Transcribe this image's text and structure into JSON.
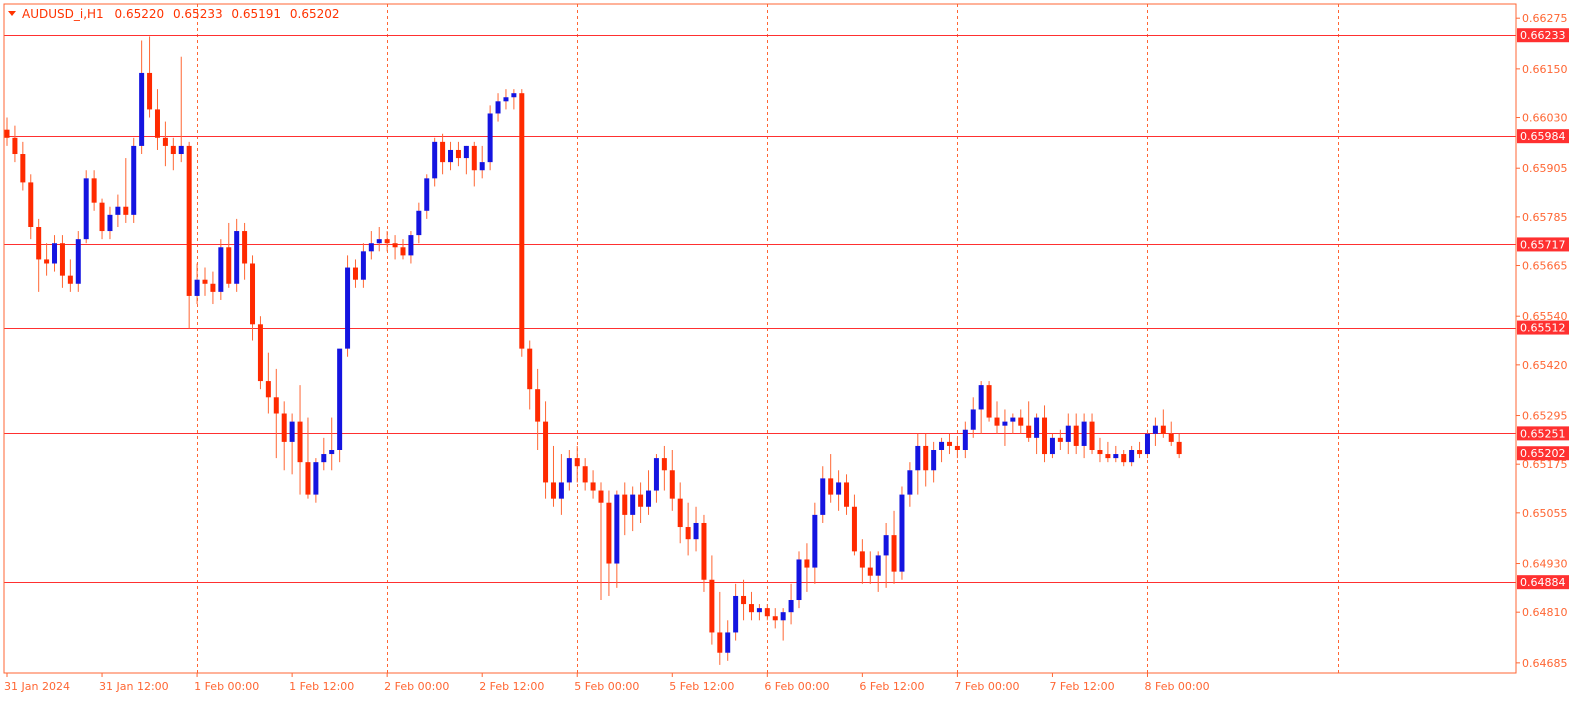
{
  "header": {
    "symbol": "AUDUSD_i,H1",
    "open": "0.65220",
    "high": "0.65233",
    "low": "0.65191",
    "close": "0.65202",
    "marker_color": "#ff3300"
  },
  "colors": {
    "background": "#ffffff",
    "frame": "#ff6633",
    "grid": "#ff6633",
    "bull": "#1414e0",
    "bear": "#ff2a00",
    "level_line": "#ff3030",
    "price_label_bg": "#ff3030",
    "axis_text": "#ff6633",
    "wick": "#ff6633"
  },
  "chart_data": {
    "type": "candlestick",
    "timeframe": "H1",
    "y_range": [
      0.6466,
      0.6631
    ],
    "y_ticks": [
      "0.66275",
      "0.66150",
      "0.66030",
      "0.65905",
      "0.65785",
      "0.65665",
      "0.65540",
      "0.65420",
      "0.65295",
      "0.65175",
      "0.65055",
      "0.64930",
      "0.64810",
      "0.64685"
    ],
    "x_labels": [
      {
        "bar": 0,
        "text": "31 Jan 2024"
      },
      {
        "bar": 12,
        "text": "31 Jan 12:00"
      },
      {
        "bar": 24,
        "text": "1 Feb 00:00"
      },
      {
        "bar": 36,
        "text": "1 Feb 12:00"
      },
      {
        "bar": 48,
        "text": "2 Feb 00:00"
      },
      {
        "bar": 60,
        "text": "2 Feb 12:00"
      },
      {
        "bar": 72,
        "text": "5 Feb 00:00"
      },
      {
        "bar": 84,
        "text": "5 Feb 12:00"
      },
      {
        "bar": 96,
        "text": "6 Feb 00:00"
      },
      {
        "bar": 108,
        "text": "6 Feb 12:00"
      },
      {
        "bar": 120,
        "text": "7 Feb 00:00"
      },
      {
        "bar": 132,
        "text": "7 Feb 12:00"
      },
      {
        "bar": 144,
        "text": "8 Feb 00:00"
      }
    ],
    "vertical_grid_bars": [
      24,
      48,
      72,
      96,
      120,
      144,
      168
    ],
    "horizontal_levels": [
      {
        "value": 0.66233,
        "label": "0.66233"
      },
      {
        "value": 0.65984,
        "label": "0.65984"
      },
      {
        "value": 0.65717,
        "label": "0.65717"
      },
      {
        "value": 0.65512,
        "label": "0.65512"
      },
      {
        "value": 0.65251,
        "label": "0.65251"
      },
      {
        "value": 0.64884,
        "label": "0.64884"
      }
    ],
    "current_price": {
      "value": 0.65202,
      "label": "0.65202"
    },
    "candles": [
      [
        0.66,
        0.6603,
        0.6596,
        0.6598
      ],
      [
        0.6598,
        0.6601,
        0.6592,
        0.6594
      ],
      [
        0.6594,
        0.6597,
        0.6585,
        0.6587
      ],
      [
        0.6587,
        0.6589,
        0.6573,
        0.6576
      ],
      [
        0.6576,
        0.6578,
        0.656,
        0.6568
      ],
      [
        0.6568,
        0.6572,
        0.6564,
        0.6567
      ],
      [
        0.6567,
        0.6574,
        0.6565,
        0.6572
      ],
      [
        0.6572,
        0.6574,
        0.6561,
        0.6564
      ],
      [
        0.6564,
        0.6568,
        0.656,
        0.6562
      ],
      [
        0.6562,
        0.6575,
        0.656,
        0.6573
      ],
      [
        0.6573,
        0.659,
        0.6572,
        0.6588
      ],
      [
        0.6588,
        0.659,
        0.658,
        0.6582
      ],
      [
        0.6582,
        0.6583,
        0.6573,
        0.6575
      ],
      [
        0.6575,
        0.6581,
        0.6573,
        0.6579
      ],
      [
        0.6579,
        0.6584,
        0.6576,
        0.6581
      ],
      [
        0.6581,
        0.6593,
        0.6577,
        0.6579
      ],
      [
        0.6579,
        0.6598,
        0.6577,
        0.6596
      ],
      [
        0.6596,
        0.6622,
        0.6594,
        0.6614
      ],
      [
        0.6614,
        0.6623,
        0.6603,
        0.6605
      ],
      [
        0.6605,
        0.661,
        0.6595,
        0.6598
      ],
      [
        0.6598,
        0.6602,
        0.6591,
        0.6596
      ],
      [
        0.6596,
        0.6598,
        0.659,
        0.6594
      ],
      [
        0.6594,
        0.6618,
        0.6592,
        0.6596
      ],
      [
        0.6596,
        0.6597,
        0.6551,
        0.6559
      ],
      [
        0.6559,
        0.6567,
        0.6557,
        0.6563
      ],
      [
        0.6563,
        0.6566,
        0.6559,
        0.6562
      ],
      [
        0.6562,
        0.6565,
        0.6557,
        0.656
      ],
      [
        0.656,
        0.6573,
        0.6558,
        0.6571
      ],
      [
        0.6571,
        0.6577,
        0.6561,
        0.6562
      ],
      [
        0.6562,
        0.6578,
        0.656,
        0.6575
      ],
      [
        0.6575,
        0.6577,
        0.6563,
        0.6567
      ],
      [
        0.6567,
        0.6569,
        0.6548,
        0.6552
      ],
      [
        0.6552,
        0.6554,
        0.6536,
        0.6538
      ],
      [
        0.6538,
        0.6545,
        0.653,
        0.6534
      ],
      [
        0.6534,
        0.6541,
        0.6519,
        0.653
      ],
      [
        0.653,
        0.6533,
        0.6516,
        0.6523
      ],
      [
        0.6523,
        0.653,
        0.6515,
        0.6528
      ],
      [
        0.6528,
        0.6537,
        0.651,
        0.6518
      ],
      [
        0.6518,
        0.6529,
        0.6509,
        0.651
      ],
      [
        0.651,
        0.6519,
        0.6508,
        0.6518
      ],
      [
        0.6518,
        0.6524,
        0.6516,
        0.652
      ],
      [
        0.652,
        0.6529,
        0.6516,
        0.6521
      ],
      [
        0.6521,
        0.6541,
        0.6518,
        0.6546
      ],
      [
        0.6546,
        0.6569,
        0.6544,
        0.6566
      ],
      [
        0.6566,
        0.6568,
        0.6561,
        0.6563
      ],
      [
        0.6563,
        0.6572,
        0.6561,
        0.657
      ],
      [
        0.657,
        0.6575,
        0.6568,
        0.6572
      ],
      [
        0.6572,
        0.6576,
        0.657,
        0.6573
      ],
      [
        0.6573,
        0.6575,
        0.657,
        0.6572
      ],
      [
        0.6572,
        0.6574,
        0.6568,
        0.6571
      ],
      [
        0.6571,
        0.6573,
        0.6568,
        0.6569
      ],
      [
        0.6569,
        0.6575,
        0.6567,
        0.6574
      ],
      [
        0.6574,
        0.6582,
        0.6572,
        0.658
      ],
      [
        0.658,
        0.6589,
        0.6578,
        0.6588
      ],
      [
        0.6588,
        0.6598,
        0.6586,
        0.6597
      ],
      [
        0.6597,
        0.6599,
        0.6589,
        0.6592
      ],
      [
        0.6592,
        0.6597,
        0.659,
        0.6595
      ],
      [
        0.6595,
        0.6597,
        0.6591,
        0.6593
      ],
      [
        0.6593,
        0.6596,
        0.6589,
        0.6596
      ],
      [
        0.6596,
        0.6597,
        0.6586,
        0.659
      ],
      [
        0.659,
        0.6596,
        0.6588,
        0.6592
      ],
      [
        0.6592,
        0.6606,
        0.659,
        0.6604
      ],
      [
        0.6604,
        0.6609,
        0.6602,
        0.6607
      ],
      [
        0.6607,
        0.661,
        0.6605,
        0.6608
      ],
      [
        0.6608,
        0.661,
        0.6605,
        0.6609
      ],
      [
        0.6609,
        0.661,
        0.6544,
        0.6546
      ],
      [
        0.6546,
        0.6548,
        0.6531,
        0.6536
      ],
      [
        0.6536,
        0.6541,
        0.6521,
        0.6528
      ],
      [
        0.6528,
        0.6533,
        0.6509,
        0.6513
      ],
      [
        0.6513,
        0.6522,
        0.6507,
        0.6509
      ],
      [
        0.6509,
        0.652,
        0.6505,
        0.6513
      ],
      [
        0.6513,
        0.6521,
        0.6511,
        0.6519
      ],
      [
        0.6519,
        0.6522,
        0.6513,
        0.6517
      ],
      [
        0.6517,
        0.6519,
        0.6511,
        0.6513
      ],
      [
        0.6513,
        0.6516,
        0.6509,
        0.6511
      ],
      [
        0.6511,
        0.6513,
        0.6484,
        0.6508
      ],
      [
        0.6508,
        0.6511,
        0.6485,
        0.6493
      ],
      [
        0.6493,
        0.6511,
        0.6487,
        0.651
      ],
      [
        0.651,
        0.6513,
        0.65,
        0.6505
      ],
      [
        0.6505,
        0.6512,
        0.6501,
        0.651
      ],
      [
        0.651,
        0.6513,
        0.6503,
        0.6507
      ],
      [
        0.6507,
        0.6516,
        0.6505,
        0.6511
      ],
      [
        0.6511,
        0.652,
        0.6508,
        0.6519
      ],
      [
        0.6519,
        0.6522,
        0.6511,
        0.6516
      ],
      [
        0.6516,
        0.6521,
        0.6506,
        0.6509
      ],
      [
        0.6509,
        0.6513,
        0.6498,
        0.6502
      ],
      [
        0.6502,
        0.6508,
        0.6495,
        0.6499
      ],
      [
        0.6499,
        0.6507,
        0.6496,
        0.6503
      ],
      [
        0.6503,
        0.6505,
        0.6486,
        0.6489
      ],
      [
        0.6489,
        0.6495,
        0.6473,
        0.6476
      ],
      [
        0.6476,
        0.6486,
        0.6468,
        0.6471
      ],
      [
        0.6471,
        0.6479,
        0.6469,
        0.6476
      ],
      [
        0.6476,
        0.6488,
        0.6474,
        0.6485
      ],
      [
        0.6485,
        0.6489,
        0.6479,
        0.6483
      ],
      [
        0.6483,
        0.6486,
        0.6479,
        0.6481
      ],
      [
        0.6481,
        0.6483,
        0.6479,
        0.6482
      ],
      [
        0.6482,
        0.6483,
        0.6479,
        0.648
      ],
      [
        0.648,
        0.6482,
        0.6477,
        0.6479
      ],
      [
        0.6479,
        0.6482,
        0.6474,
        0.6481
      ],
      [
        0.6481,
        0.6488,
        0.6478,
        0.6484
      ],
      [
        0.6484,
        0.6496,
        0.6482,
        0.6494
      ],
      [
        0.6494,
        0.6498,
        0.6486,
        0.6492
      ],
      [
        0.6492,
        0.6508,
        0.6488,
        0.6505
      ],
      [
        0.6505,
        0.6517,
        0.6503,
        0.6514
      ],
      [
        0.6514,
        0.652,
        0.6508,
        0.651
      ],
      [
        0.651,
        0.6516,
        0.6506,
        0.6513
      ],
      [
        0.6513,
        0.6515,
        0.6505,
        0.6507
      ],
      [
        0.6507,
        0.651,
        0.6495,
        0.6496
      ],
      [
        0.6496,
        0.6499,
        0.6488,
        0.6492
      ],
      [
        0.6492,
        0.6496,
        0.6488,
        0.649
      ],
      [
        0.649,
        0.6496,
        0.6486,
        0.6495
      ],
      [
        0.6495,
        0.6503,
        0.6487,
        0.65
      ],
      [
        0.65,
        0.6506,
        0.6488,
        0.6491
      ],
      [
        0.6491,
        0.6512,
        0.6489,
        0.651
      ],
      [
        0.651,
        0.6518,
        0.6507,
        0.6516
      ],
      [
        0.6516,
        0.6525,
        0.651,
        0.6522
      ],
      [
        0.6522,
        0.6525,
        0.6512,
        0.6516
      ],
      [
        0.6516,
        0.6523,
        0.6513,
        0.6521
      ],
      [
        0.6521,
        0.6524,
        0.6518,
        0.6523
      ],
      [
        0.6523,
        0.6525,
        0.652,
        0.6522
      ],
      [
        0.6522,
        0.6524,
        0.6519,
        0.6521
      ],
      [
        0.6521,
        0.6528,
        0.6519,
        0.6526
      ],
      [
        0.6526,
        0.6534,
        0.6524,
        0.6531
      ],
      [
        0.6531,
        0.6538,
        0.6525,
        0.6537
      ],
      [
        0.6537,
        0.6538,
        0.6528,
        0.6529
      ],
      [
        0.6529,
        0.6533,
        0.6525,
        0.6527
      ],
      [
        0.6527,
        0.6531,
        0.6522,
        0.6528
      ],
      [
        0.6528,
        0.653,
        0.6525,
        0.6529
      ],
      [
        0.6529,
        0.6531,
        0.6525,
        0.6527
      ],
      [
        0.6527,
        0.6533,
        0.6523,
        0.6524
      ],
      [
        0.6524,
        0.653,
        0.652,
        0.6529
      ],
      [
        0.6529,
        0.6532,
        0.6518,
        0.652
      ],
      [
        0.652,
        0.6525,
        0.6519,
        0.6524
      ],
      [
        0.6524,
        0.6526,
        0.6521,
        0.6523
      ],
      [
        0.6523,
        0.653,
        0.652,
        0.6527
      ],
      [
        0.6527,
        0.653,
        0.652,
        0.6522
      ],
      [
        0.6522,
        0.653,
        0.6519,
        0.6528
      ],
      [
        0.6528,
        0.653,
        0.652,
        0.6521
      ],
      [
        0.6521,
        0.6524,
        0.6518,
        0.652
      ],
      [
        0.652,
        0.6523,
        0.6518,
        0.6519
      ],
      [
        0.6519,
        0.6522,
        0.6518,
        0.652
      ],
      [
        0.652,
        0.6521,
        0.6517,
        0.6518
      ],
      [
        0.6518,
        0.6522,
        0.6517,
        0.6521
      ],
      [
        0.6521,
        0.6523,
        0.6519,
        0.652
      ],
      [
        0.652,
        0.6526,
        0.6519,
        0.6525
      ],
      [
        0.6525,
        0.6529,
        0.6522,
        0.6527
      ],
      [
        0.6527,
        0.6531,
        0.6524,
        0.6525
      ],
      [
        0.6525,
        0.6528,
        0.6522,
        0.6523
      ],
      [
        0.6523,
        0.6525,
        0.6519,
        0.652
      ]
    ]
  }
}
